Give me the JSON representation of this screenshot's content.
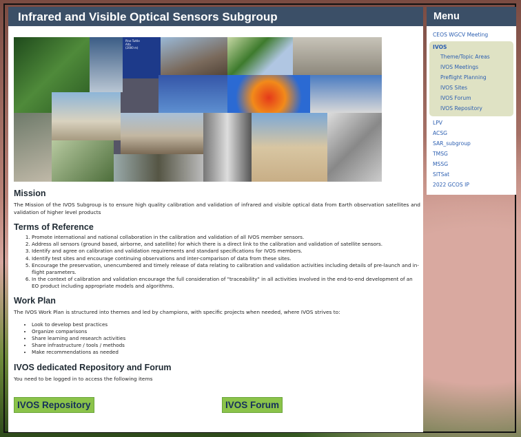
{
  "page": {
    "title": "Infrared and Visible Optical Sensors Subgroup"
  },
  "banner": {
    "caption_lines": [
      "Pine Tuttle",
      "Alta",
      "(2000 m)"
    ]
  },
  "mission": {
    "heading": "Mission",
    "text": "The Mission of the IVOS Subgroup is to ensure high quality calibration and validation of infrared and visible optical data from Earth observation satellites and validation of higher level products"
  },
  "terms": {
    "heading": "Terms of Reference",
    "items": [
      "Promote international and national collaboration in the calibration and validation of all IVOS member sensors.",
      "Address all sensors (ground based, airborne, and satellite) for which there is a direct link to the calibration and validation of satellite sensors.",
      "Identify and agree on calibration and validation requirements and standard specifications for IVOS members.",
      "Identify test sites and encourage continuing observations and inter-comparison of data from these sites.",
      "Encourage the preservation, unencumbered and timely release of data relating to calibration and validation activities including details of pre-launch and in-flight parameters.",
      "In the context of calibration and validation encourage the full consideration of \"traceability\" in all activities involved in the end-to-end development of an EO product including appropriate models and algorithms."
    ]
  },
  "workplan": {
    "heading": "Work Plan",
    "intro": "The IVOS Work Plan is structured into themes and led by champions, with specific projects when needed, where IVOS strives to:",
    "items": [
      "Look to develop best practices",
      "Organize comparisons",
      "Share learning and research activities",
      "Share infrastructure / tools / methods",
      "Make recommendations as needed"
    ]
  },
  "repo": {
    "heading": "IVOS dedicated Repository and Forum",
    "text": "You need to be logged in to access the following items",
    "repository_button": "IVOS Repository",
    "forum_button": "IVOS Forum"
  },
  "menu": {
    "title": "Menu",
    "top_item": "CEOS WGCV Meeting",
    "group": {
      "title": "IVOS",
      "items": [
        "Theme/Topic Areas",
        "IVOS Meetings",
        "Preflight Planning",
        "IVOS Sites",
        "IVOS Forum",
        "IVOS Repository"
      ]
    },
    "items": [
      "LPV",
      "ACSG",
      "SAR_subgroup",
      "TMSG",
      "MSSG",
      "SITSat",
      "2022 GCOS IP"
    ]
  },
  "colors": {
    "header_bg": "#3b4f67",
    "link": "#2a5db0",
    "button_bg": "#8bc34a",
    "menu_group_bg": "#dfe2c4"
  }
}
